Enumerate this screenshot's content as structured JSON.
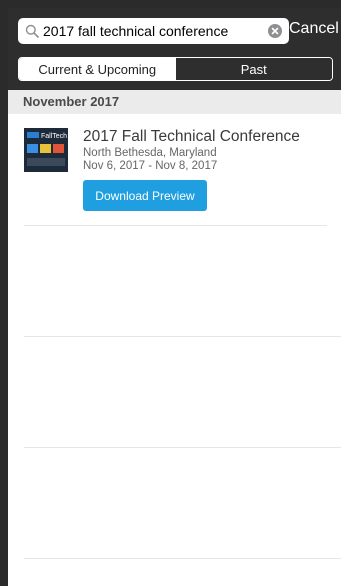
{
  "search": {
    "value": "2017 fall technical conference",
    "cancel_label": "Cancel"
  },
  "tabs": [
    {
      "label": "Current & Upcoming",
      "selected": true
    },
    {
      "label": "Past",
      "selected": false
    }
  ],
  "section": {
    "title": "November 2017"
  },
  "event": {
    "thumbnail_text": "FallTech",
    "title": "2017 Fall Technical Conference",
    "location": "North Bethesda, Maryland",
    "dates": "Nov 6, 2017 - Nov 8, 2017",
    "button_label": "Download Preview"
  },
  "colors": {
    "header_bg": "#2e2e2e",
    "accent": "#1f9fe0",
    "section_bg": "#ebebeb"
  }
}
